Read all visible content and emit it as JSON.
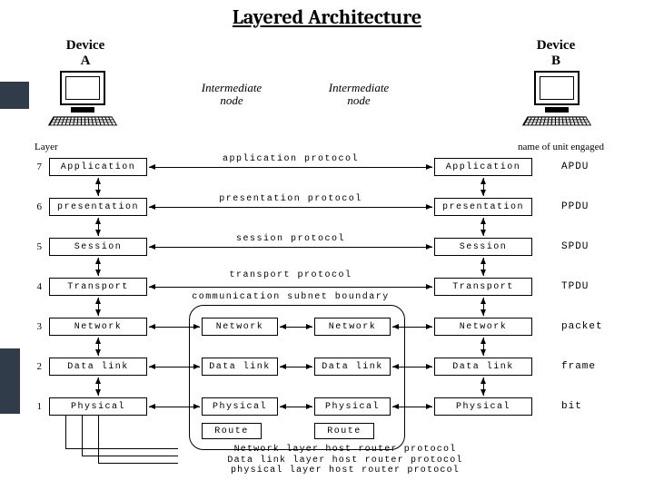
{
  "title": "Layered Architecture",
  "devices": {
    "a": "Device\nA",
    "b": "Device\nB"
  },
  "intermediates": {
    "left": "Intermediate\nnode",
    "right": "Intermediate\nnode"
  },
  "col_headers": {
    "layer": "Layer",
    "unit": "name of unit engaged"
  },
  "layer_nums": [
    "7",
    "6",
    "5",
    "4",
    "3",
    "2",
    "1"
  ],
  "layers": {
    "application": "Application",
    "presentation": "presentation",
    "session": "Session",
    "transport": "Transport",
    "network": "Network",
    "datalink": "Data link",
    "physical": "Physical",
    "route": "Route"
  },
  "protocols": {
    "application": "application protocol",
    "presentation": "presentation protocol",
    "session": "session protocol",
    "transport": "transport protocol",
    "boundary": "communication subnet boundary"
  },
  "units": {
    "apdu": "APDU",
    "ppdu": "PPDU",
    "spdu": "SPDU",
    "tpdu": "TPDU",
    "packet": "packet",
    "frame": "frame",
    "bit": "bit"
  },
  "footer_lines": [
    "Network layer host router protocol",
    "Data link layer host router protocol",
    "physical layer host router protocol"
  ]
}
